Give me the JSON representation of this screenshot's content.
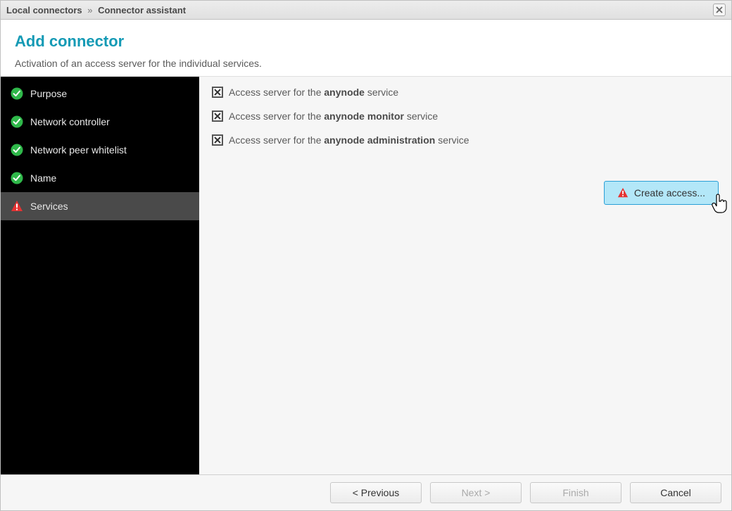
{
  "titlebar": {
    "crumb1": "Local connectors",
    "sep": "»",
    "crumb2": "Connector assistant"
  },
  "header": {
    "title": "Add connector",
    "subtitle": "Activation of an access server for the individual services."
  },
  "sidebar": {
    "items": [
      {
        "label": "Purpose",
        "status": "ok"
      },
      {
        "label": "Network controller",
        "status": "ok"
      },
      {
        "label": "Network peer whitelist",
        "status": "ok"
      },
      {
        "label": "Name",
        "status": "ok"
      },
      {
        "label": "Services",
        "status": "warn"
      }
    ]
  },
  "services": [
    {
      "prefix": "Access server for the ",
      "bold": "anynode",
      "suffix": " service",
      "checked": true
    },
    {
      "prefix": "Access server for the ",
      "bold": "anynode monitor",
      "suffix": " service",
      "checked": true
    },
    {
      "prefix": "Access server for the ",
      "bold": "anynode administration",
      "suffix": " service",
      "checked": true
    }
  ],
  "create_button": {
    "label": "Create access..."
  },
  "footer": {
    "previous": "< Previous",
    "next": "Next >",
    "finish": "Finish",
    "cancel": "Cancel"
  }
}
